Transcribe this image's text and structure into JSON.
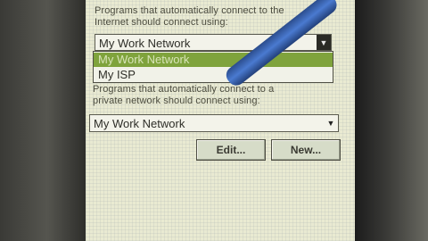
{
  "section1": {
    "label": "Programs that automatically connect to the\nInternet should connect using:",
    "selected": "My Work Network",
    "options": [
      "My Work Network",
      "My ISP"
    ]
  },
  "section2": {
    "label": "Programs that automatically connect to a\nprivate network should connect using:",
    "selected": "My Work Network"
  },
  "buttons": {
    "edit": "Edit...",
    "new": "New..."
  },
  "colors": {
    "highlight": "#7fa33c",
    "screen": "#e9ead2"
  },
  "icons": [
    "dropdown-arrow-icon"
  ]
}
